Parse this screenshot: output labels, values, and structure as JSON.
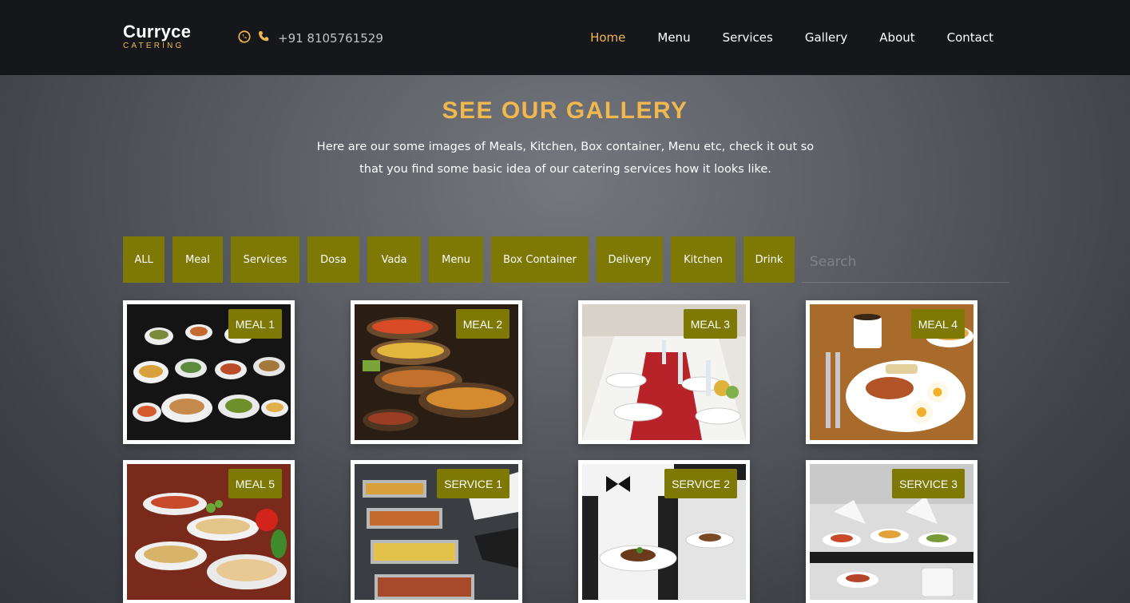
{
  "brand": {
    "name": "Curryce",
    "tagline": "CATERING"
  },
  "contact": {
    "phone": "+91 8105761529",
    "icons": [
      "whatsapp-icon",
      "phone-icon"
    ]
  },
  "nav": {
    "items": [
      "Home",
      "Menu",
      "Services",
      "Gallery",
      "About",
      "Contact"
    ],
    "active": "Home"
  },
  "gallery": {
    "title": "SEE OUR GALLERY",
    "description": "Here are our some images of Meals, Kitchen, Box container, Menu etc, check it out so that you find some basic idea of our catering services how it looks like."
  },
  "filters": [
    "ALL",
    "Meal",
    "Services",
    "Dosa",
    "Vada",
    "Menu",
    "Box Container",
    "Delivery",
    "Kitchen",
    "Drink"
  ],
  "search": {
    "placeholder": "Search",
    "value": ""
  },
  "cards": [
    "MEAL 1",
    "MEAL 2",
    "MEAL 3",
    "MEAL 4",
    "MEAL 5",
    "SERVICE 1",
    "SERVICE 2",
    "SERVICE 3"
  ],
  "colors": {
    "accent": "#f0b84f",
    "filter_bg": "#7e7804",
    "navbar_bg": "#15171a"
  }
}
